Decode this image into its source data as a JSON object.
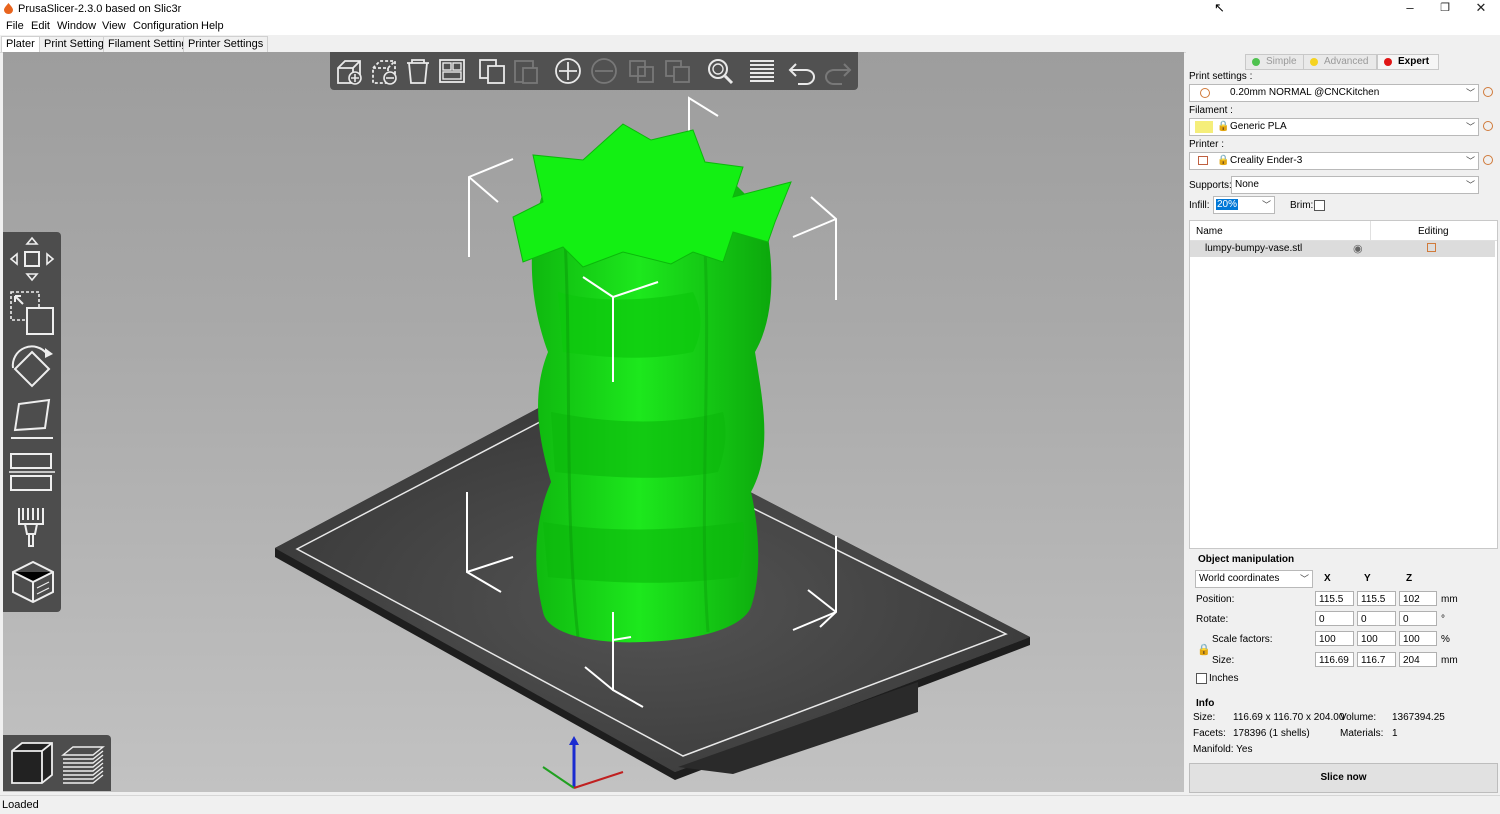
{
  "window": {
    "title": "PrusaSlicer-2.3.0 based on Slic3r",
    "minimize": "–",
    "restore": "❐",
    "close": "✕"
  },
  "menu": [
    "File",
    "Edit",
    "Window",
    "View",
    "Configuration",
    "Help"
  ],
  "tabs": [
    "Plater",
    "Print Settings",
    "Filament Settings",
    "Printer Settings"
  ],
  "mode": {
    "simple": "Simple",
    "advanced": "Advanced",
    "expert": "Expert"
  },
  "colors": {
    "simple": "#4fc24f",
    "advanced": "#f5d321",
    "expert": "#e01515",
    "model": "#16e316",
    "bed": "#3a3a3a",
    "toolbar": "#4d4d4d",
    "filament": "#f5ee7a"
  },
  "settings": {
    "print_label": "Print settings :",
    "print_value": "0.20mm NORMAL @CNCKitchen",
    "filament_label": "Filament :",
    "filament_value": "Generic PLA",
    "printer_label": "Printer :",
    "printer_value": "Creality Ender-3",
    "supports_label": "Supports:",
    "supports_value": "None",
    "infill_label": "Infill:",
    "infill_value": "20%",
    "brim_label": "Brim:"
  },
  "object_list": {
    "col_name": "Name",
    "col_editing": "Editing",
    "items": [
      {
        "name": "lumpy-bumpy-vase.stl"
      }
    ]
  },
  "manipulation": {
    "title": "Object manipulation",
    "coord_system": "World coordinates",
    "axes": [
      "X",
      "Y",
      "Z"
    ],
    "position_label": "Position:",
    "position": [
      "115.5",
      "115.5",
      "102"
    ],
    "position_unit": "mm",
    "rotate_label": "Rotate:",
    "rotate": [
      "0",
      "0",
      "0"
    ],
    "rotate_unit": "°",
    "scale_label": "Scale factors:",
    "scale": [
      "100",
      "100",
      "100"
    ],
    "scale_unit": "%",
    "size_label": "Size:",
    "size": [
      "116.69",
      "116.7",
      "204"
    ],
    "size_unit": "mm",
    "inches_label": "Inches"
  },
  "info": {
    "title": "Info",
    "size_label": "Size:",
    "size_value": "116.69 x 116.70 x 204.00",
    "volume_label": "Volume:",
    "volume_value": "1367394.25",
    "facets_label": "Facets:",
    "facets_value": "178396 (1 shells)",
    "materials_label": "Materials:",
    "materials_value": "1",
    "manifold_label": "Manifold: Yes"
  },
  "slice_button": "Slice now",
  "status": "Loaded"
}
